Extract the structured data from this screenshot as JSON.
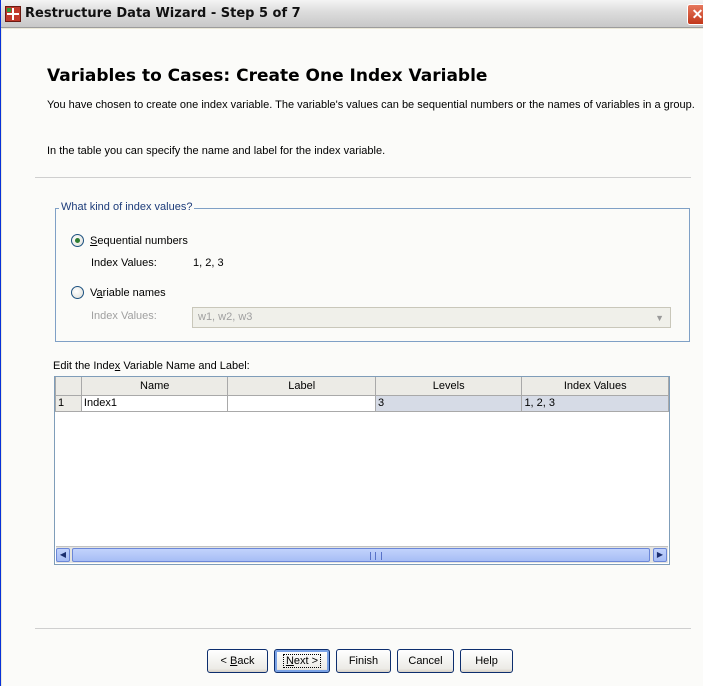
{
  "window": {
    "title": "Restructure Data Wizard - Step 5 of 7",
    "close_glyph": "✕"
  },
  "header": {
    "title": "Variables to Cases: Create One Index Variable",
    "description": "You have chosen to create one index variable. The variable's values can be sequential numbers or the names of variables in a group.",
    "description2": "In the table you can specify the name and label for the index variable."
  },
  "index_kind": {
    "legend": "What kind of index values?",
    "sequential": {
      "label_pre": "",
      "label_key": "S",
      "label_post": "equential numbers",
      "checked": true,
      "values_label": "Index Values:",
      "values": "1, 2, 3"
    },
    "variable_names": {
      "label_pre": "V",
      "label_key": "a",
      "label_post": "riable names",
      "checked": false,
      "values_label": "Index Values:",
      "combo_value": "w1, w2, w3"
    }
  },
  "grid": {
    "label_pre": "Edit the Inde",
    "label_key": "x",
    "label_post": " Variable Name and Label:",
    "columns": [
      "Name",
      "Label",
      "Levels",
      "Index Values"
    ],
    "rows": [
      {
        "num": "1",
        "name": "Index1",
        "label": "",
        "levels": "3",
        "index_values": "1, 2, 3"
      }
    ]
  },
  "buttons": {
    "back_pre": "< ",
    "back_key": "B",
    "back_post": "ack",
    "next_key": "N",
    "next_post": "ext >",
    "finish": "Finish",
    "cancel": "Cancel",
    "help": "Help"
  }
}
